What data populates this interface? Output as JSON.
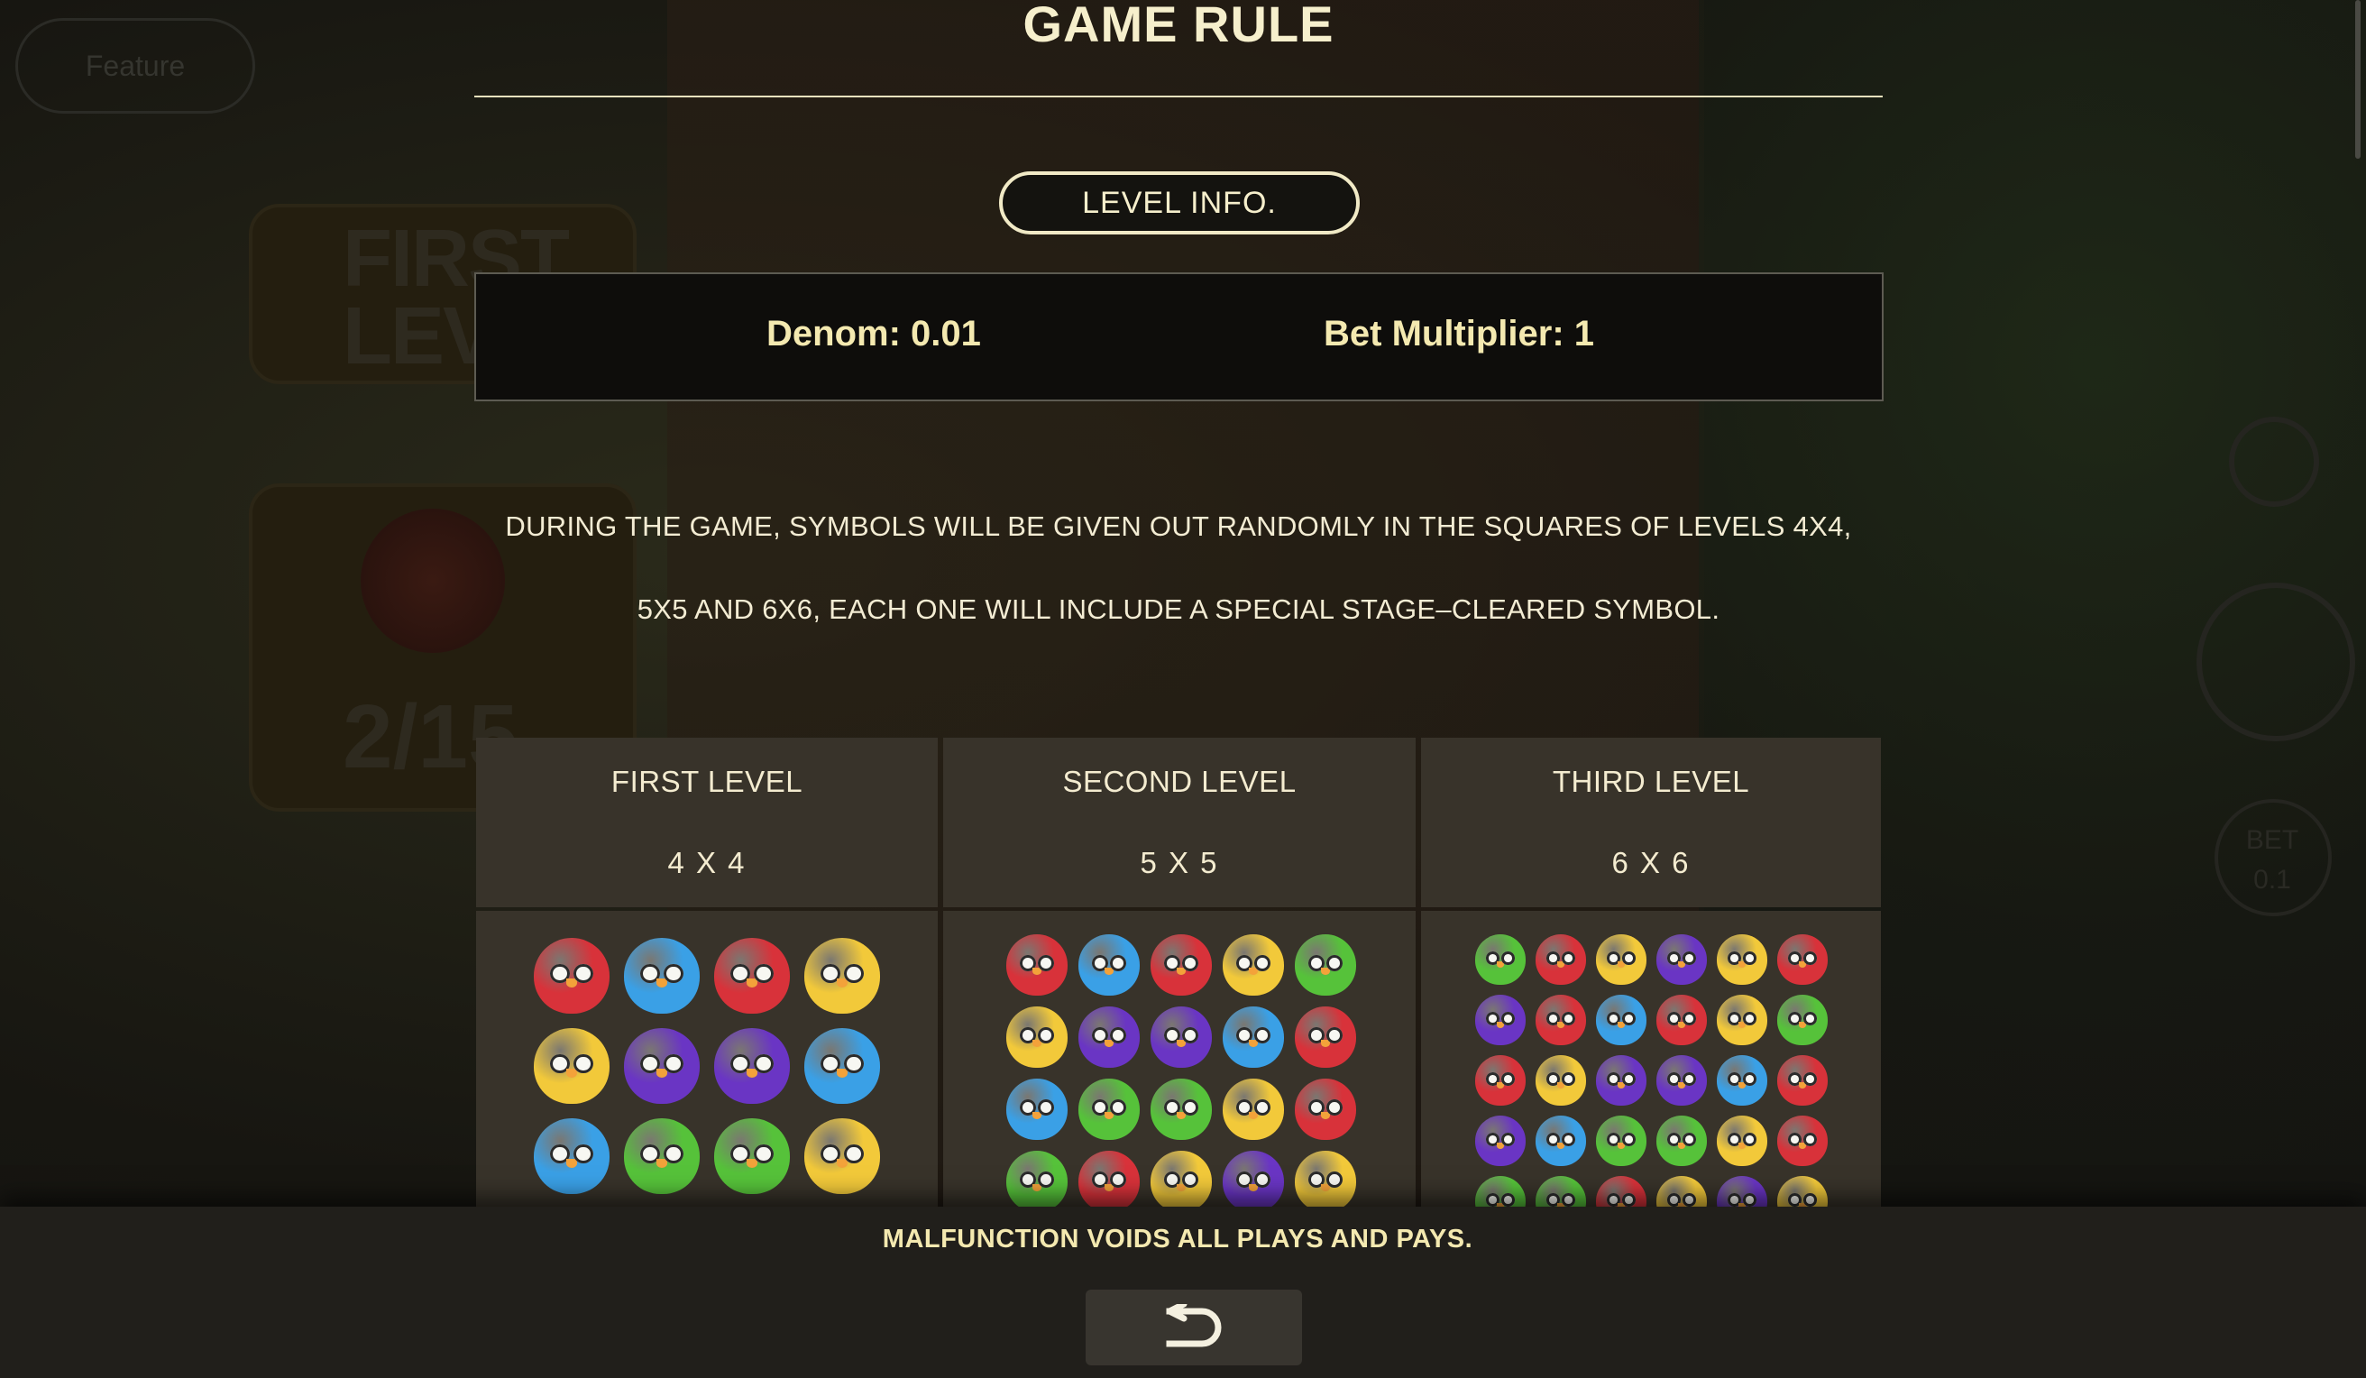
{
  "background": {
    "feature_label": "Feature",
    "card_level_text": "FIRST LEVEL",
    "card_count_text": "2/15",
    "bet_label": "BET",
    "bet_value": "0.1"
  },
  "page": {
    "title": "GAME RULE",
    "level_info_label": "LEVEL INFO.",
    "denom_text": "Denom: 0.01",
    "bet_multiplier_text": "Bet Multiplier: 1",
    "description_line1": "DURING THE GAME, SYMBOLS WILL BE GIVEN OUT RANDOMLY IN THE SQUARES OF LEVELS 4X4,",
    "description_line2": "5X5 AND 6X6, EACH ONE WILL INCLUDE A SPECIAL STAGE–CLEARED SYMBOL."
  },
  "levels": [
    {
      "name": "FIRST LEVEL",
      "size": "4 X 4",
      "rows": [
        [
          "red",
          "blue",
          "red",
          "yellow"
        ],
        [
          "yellow",
          "purple",
          "purple",
          "blue"
        ],
        [
          "blue",
          "green",
          "green",
          "yellow"
        ]
      ]
    },
    {
      "name": "SECOND LEVEL",
      "size": "5 X 5",
      "rows": [
        [
          "red",
          "blue",
          "red",
          "yellow",
          "green"
        ],
        [
          "yellow",
          "purple",
          "purple",
          "blue",
          "red"
        ],
        [
          "blue",
          "green",
          "green",
          "yellow",
          "red"
        ],
        [
          "green",
          "red",
          "yellow",
          "purple",
          "yellow"
        ]
      ]
    },
    {
      "name": "THIRD LEVEL",
      "size": "6 X 6",
      "rows": [
        [
          "green",
          "red",
          "yellow",
          "purple",
          "yellow",
          "red"
        ],
        [
          "purple",
          "red",
          "blue",
          "red",
          "yellow",
          "green"
        ],
        [
          "red",
          "yellow",
          "purple",
          "purple",
          "blue",
          "red"
        ],
        [
          "purple",
          "blue",
          "green",
          "green",
          "yellow",
          "red"
        ],
        [
          "green",
          "green",
          "red",
          "yellow",
          "purple",
          "yellow"
        ]
      ]
    }
  ],
  "bird_colors": {
    "red": "#d8323a",
    "blue": "#3aa0e6",
    "yellow": "#f2c93a",
    "purple": "#6a35c4",
    "green": "#56c23a"
  },
  "footer": {
    "notice": "MALFUNCTION VOIDS ALL PLAYS AND PAYS.",
    "back_icon": "return-arrow-icon"
  }
}
